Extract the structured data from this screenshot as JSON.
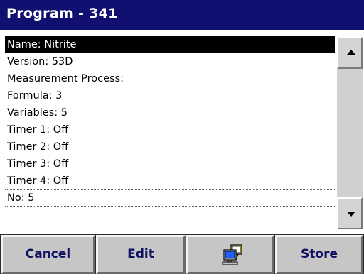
{
  "window": {
    "title": "Program - 341"
  },
  "list": {
    "items": [
      "Name: Nitrite",
      "Version: 53D",
      "Measurement Process:",
      "Formula: 3",
      "Variables: 5",
      "Timer 1: Off",
      "Timer 2: Off",
      "Timer 3: Off",
      "Timer 4: Off",
      "No: 5"
    ],
    "selected_index": 0
  },
  "scrollbar": {
    "up_icon": "arrow-up-icon",
    "down_icon": "arrow-down-icon"
  },
  "toolbar": {
    "cancel_label": "Cancel",
    "edit_label": "Edit",
    "pc_icon": "computer-icon",
    "store_label": "Store"
  },
  "colors": {
    "title_bar": "#101070",
    "button_text": "#101060",
    "selected_row": "#000000"
  }
}
